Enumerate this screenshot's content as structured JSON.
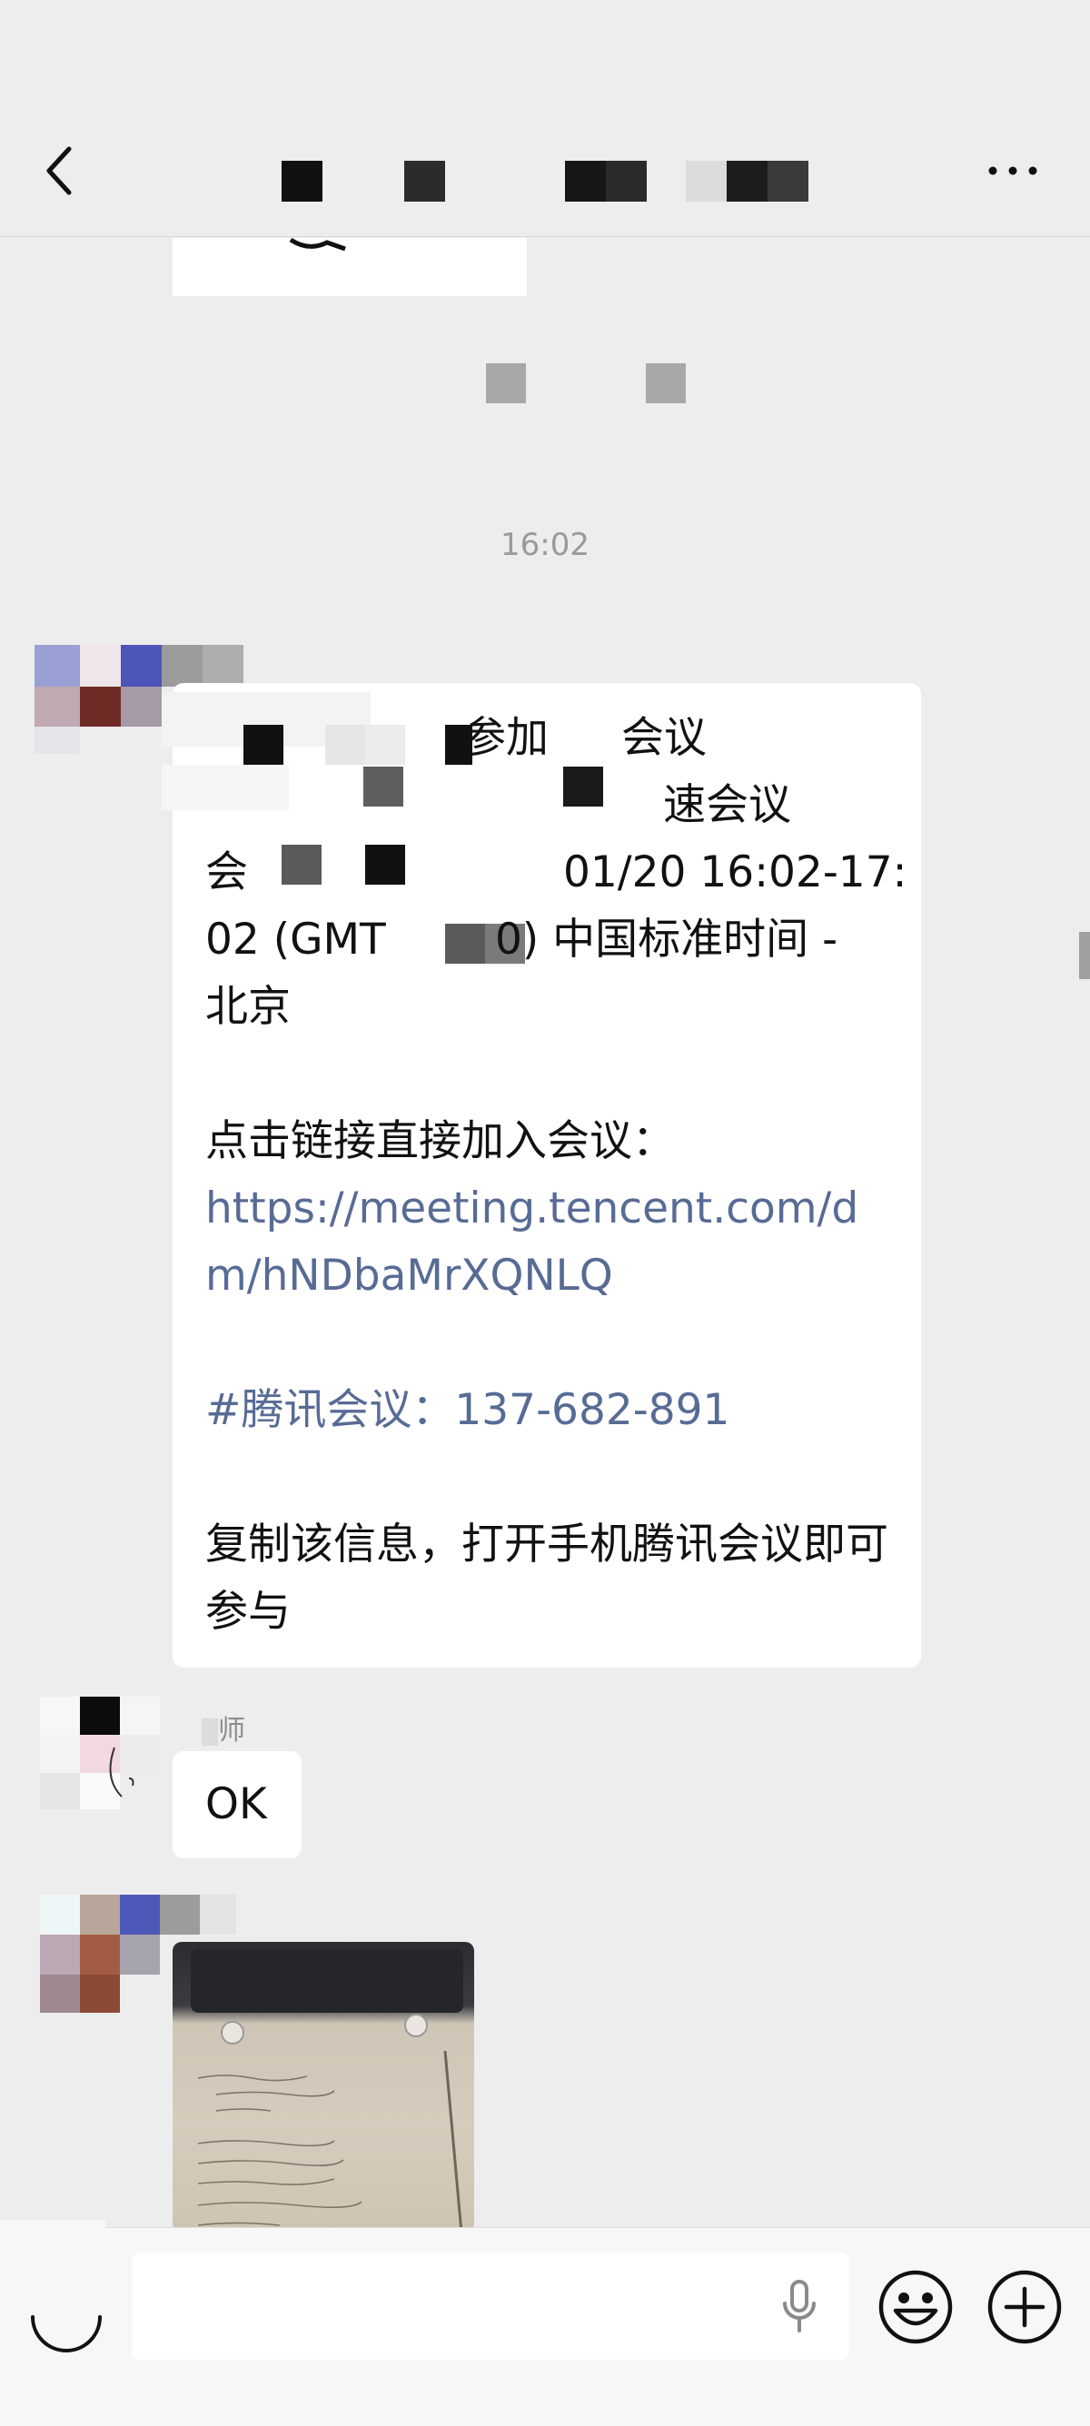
{
  "timestamp": "16:02",
  "meeting_message": {
    "line1": "参加",
    "line1b": "会议",
    "line2": "速会议",
    "line3": "01/20 16:02-17:",
    "line3_left": "会",
    "line4_left": "02 (GMT",
    "line4_right": "0) 中国标准时间 -",
    "line5": "北京",
    "join_prompt": "点击链接直接加入会议：",
    "link": "https://meeting.tencent.com/dm/hNDbaMrXQNLQ",
    "meeting_id": "#腾讯会议：137-682-891",
    "copy_hint": "复制该信息，打开手机腾讯会议即可参与"
  },
  "reply_message": {
    "sender_suffix": "师",
    "text": "OK"
  },
  "icons": {
    "back": "back-arrow-icon",
    "more": "more-dots-icon",
    "voice": "voice-toggle-icon",
    "mic": "microphone-icon",
    "emoji": "emoji-icon",
    "plus": "plus-icon"
  },
  "colors": {
    "background": "#ededed",
    "link": "#576b95",
    "bubble": "#ffffff"
  }
}
